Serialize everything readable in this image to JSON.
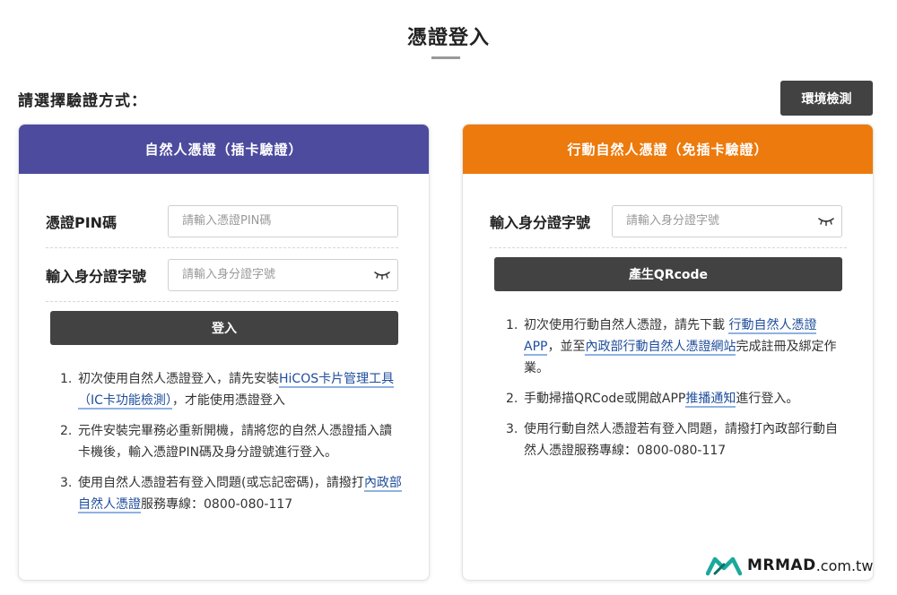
{
  "page": {
    "title": "憑證登入",
    "choose_label": "請選擇驗證方式：",
    "env_button": "環境檢測"
  },
  "left_card": {
    "header": "自然人憑證（插卡驗證）",
    "pin_label": "憑證PIN碼",
    "pin_placeholder": "請輸入憑證PIN碼",
    "id_label": "輸入身分證字號",
    "id_placeholder": "請輸入身分證字號",
    "login_button": "登入",
    "notes": [
      {
        "num": "1.",
        "parts": [
          {
            "text": "初次使用自然人憑證登入，請先安裝"
          },
          {
            "text": "HiCOS卡片管理工具（IC卡功能檢測）",
            "link": true
          },
          {
            "text": "，才能使用憑證登入"
          }
        ]
      },
      {
        "num": "2.",
        "parts": [
          {
            "text": "元件安裝完畢務必重新開機，請將您的自然人憑證插入讀卡機後，輸入憑證PIN碼及身分證號進行登入。"
          }
        ]
      },
      {
        "num": "3.",
        "parts": [
          {
            "text": "使用自然人憑證若有登入問題(或忘記密碼)，請撥打"
          },
          {
            "text": "內政部自然人憑證",
            "link": true
          },
          {
            "text": "服務專線：0800-080-117"
          }
        ]
      }
    ]
  },
  "right_card": {
    "header": "行動自然人憑證（免插卡驗證）",
    "id_label": "輸入身分證字號",
    "id_placeholder": "請輸入身分證字號",
    "qr_button": "產生QRcode",
    "notes": [
      {
        "num": "1.",
        "parts": [
          {
            "text": "初次使用行動自然人憑證，請先下載 "
          },
          {
            "text": "行動自然人憑證APP",
            "link": true
          },
          {
            "text": "，並至"
          },
          {
            "text": "內政部行動自然人憑證網站",
            "link": true
          },
          {
            "text": "完成註冊及綁定作業。"
          }
        ]
      },
      {
        "num": "2.",
        "parts": [
          {
            "text": "手動掃描QRCode或開啟APP"
          },
          {
            "text": "推播通知",
            "link": true
          },
          {
            "text": "進行登入。"
          }
        ]
      },
      {
        "num": "3.",
        "parts": [
          {
            "text": "使用行動自然人憑證若有登入問題，請撥打內政部行動自然人憑證服務專線：0800-080-117"
          }
        ]
      }
    ]
  },
  "watermark": {
    "brand": "MRMAD",
    "domain": ".com.tw"
  },
  "colors": {
    "left_header": "#4d4b9e",
    "right_header": "#ed7a0c",
    "button_dark": "#424242",
    "link": "#1f4e9c",
    "logo_teal": "#1aa99b"
  },
  "icons": {
    "password_toggle": "eye-closed-icon",
    "logo": "mrmad-logo-icon"
  }
}
